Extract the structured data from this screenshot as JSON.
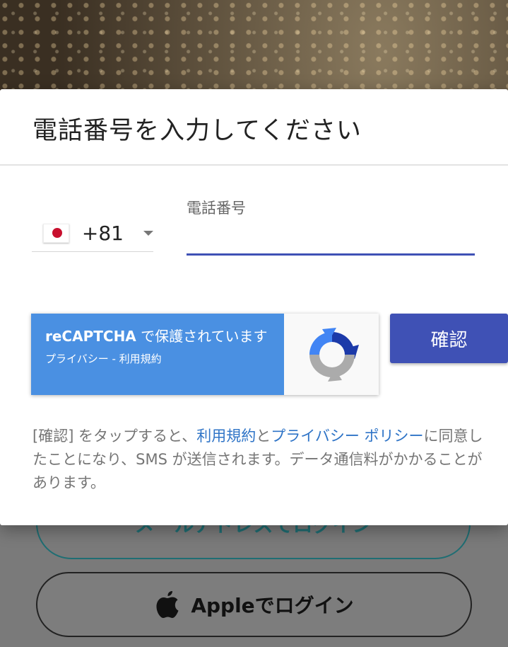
{
  "dialog": {
    "title": "電話番号を入力してください",
    "country_code": "+81",
    "phone_label": "電話番号",
    "phone_value": "",
    "recaptcha": {
      "brand": "reCAPTCHA",
      "protected_text": " で保護されています",
      "privacy_link": "プライバシー",
      "separator": " - ",
      "terms_link": "利用規約"
    },
    "confirm_label": "確認",
    "terms": {
      "prefix": "[確認] をタップすると、",
      "terms_link": "利用規約",
      "and": "と",
      "privacy_link": "プライバシー ポリシー",
      "suffix": "に同意したことになり、SMS が送信されます。データ通信料がかかることがあります。"
    }
  },
  "background": {
    "email_login_label": "メールアドレスでログイン",
    "apple_login_label": "Appleでログイン"
  },
  "icons": {
    "flag": "japan-flag-icon",
    "caret": "chevron-down-icon",
    "recaptcha": "recaptcha-logo-icon",
    "apple": "apple-icon"
  },
  "colors": {
    "primary": "#3f51b5",
    "recaptcha_blue": "#4a90e2",
    "link": "#2f74c7",
    "email_button": "#1f6e73"
  }
}
